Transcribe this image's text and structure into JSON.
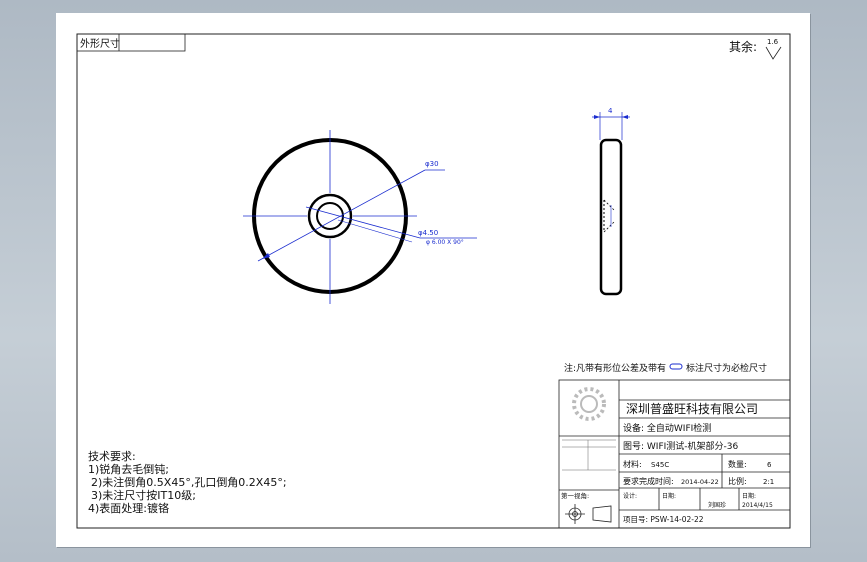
{
  "drawing": {
    "top_label": "外形尺寸",
    "roughness": {
      "label": "其余:",
      "value": "1.6"
    },
    "dims": {
      "outer": "φ30",
      "hole": "φ4.50",
      "hole_tol": "φ 6.00 X 90°",
      "thickness": "4"
    },
    "note": {
      "prefix": "注:凡带有形位公差及带有",
      "suffix": "标注尺寸为必检尺寸"
    },
    "tech": {
      "title": "技术要求:",
      "items": [
        "1)锐角去毛倒钝;",
        "2)未注倒角0.5X45°,孔口倒角0.2X45°;",
        "3)未注尺寸按IT10级;",
        "4)表面处理:镀铬"
      ]
    },
    "title_block": {
      "company": "深圳普盛旺科技有限公司",
      "equipment": "设备: 全自动WIFI检测",
      "drawing_no": "图号: WIFI测试-机架部分-36",
      "material_label": "材料:",
      "material": "S45C",
      "qty_label": "数量:",
      "qty": "6",
      "due_label": "要求完成时间:",
      "due": "2014-04-22",
      "scale_label": "比例:",
      "scale": "2:1",
      "design": "设计:",
      "date1": "日期:",
      "designer": "刘国珍",
      "date2": "日期:",
      "date2_value": "2014/4/15",
      "angle_label": "第一视角:",
      "project": "项目号: PSW-14-02-22"
    }
  }
}
